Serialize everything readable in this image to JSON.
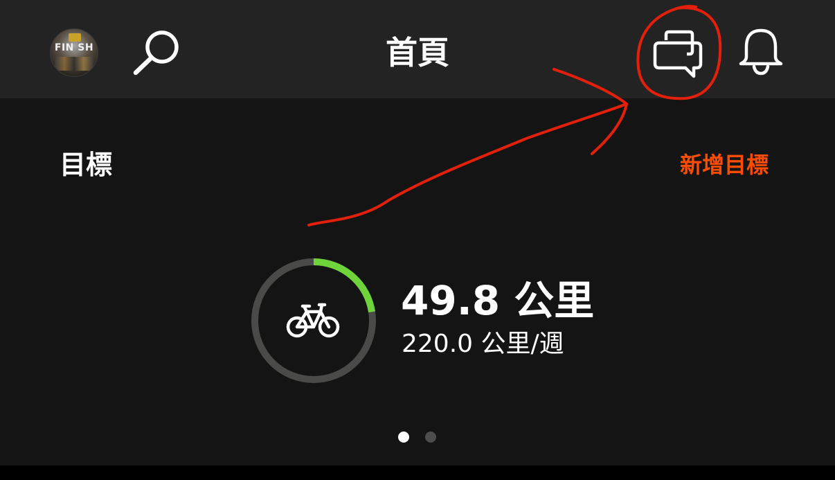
{
  "header": {
    "title": "首頁",
    "avatar_text": "FIN SH",
    "icons": [
      "search-icon",
      "chat-icon",
      "bell-icon"
    ]
  },
  "goals": {
    "label": "目標",
    "add_label": "新增目標",
    "add_color": "#fc4c02",
    "current": {
      "distance": "49.8 公里",
      "target": "220.0 公里/週",
      "progress_fraction": 0.226,
      "progress_color": "#6fd43c",
      "track_color": "#4a4a48",
      "activity_icon": "bike-icon"
    }
  },
  "pager": {
    "count": 2,
    "active_index": 0
  },
  "annotation": {
    "color": "#e3200b"
  }
}
